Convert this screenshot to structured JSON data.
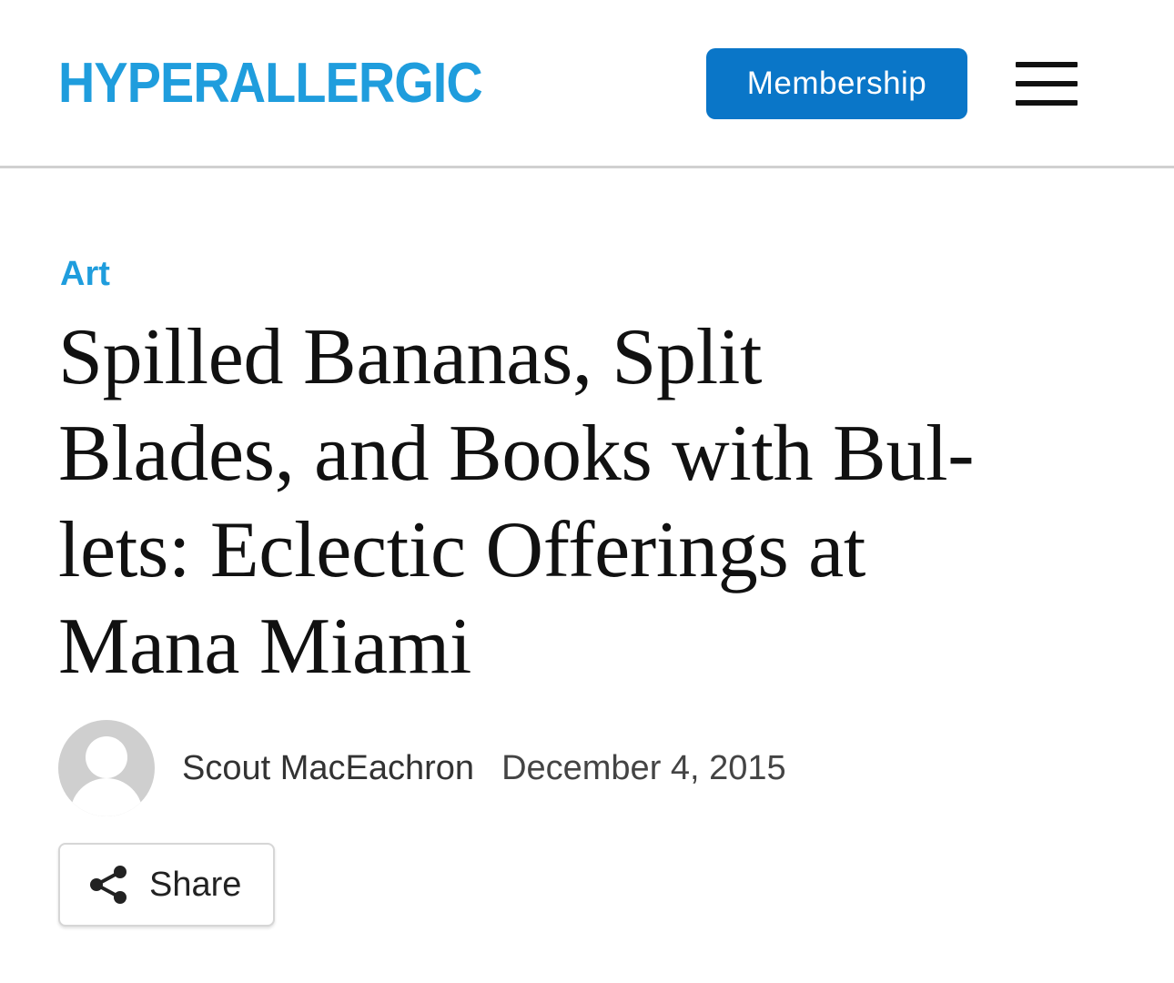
{
  "header": {
    "logo_text": "HYPERALLERGIC",
    "membership_label": "Membership",
    "menu_icon": "hamburger-menu-icon"
  },
  "article": {
    "category": "Art",
    "headline_lines": [
      "Spilled Bananas, Split",
      "Blades, and Books with Bul-",
      "lets: Eclectic Offerings at",
      "Mana Miami"
    ],
    "author": "Scout MacEachron",
    "date": "December 4, 2015",
    "share_label": "Share",
    "share_icon": "share-icon",
    "avatar_icon": "default-avatar-icon"
  },
  "colors": {
    "brand_blue": "#1f9ddd",
    "button_blue": "#0a76c8",
    "text": "#111111",
    "divider": "#d0d0d0"
  }
}
